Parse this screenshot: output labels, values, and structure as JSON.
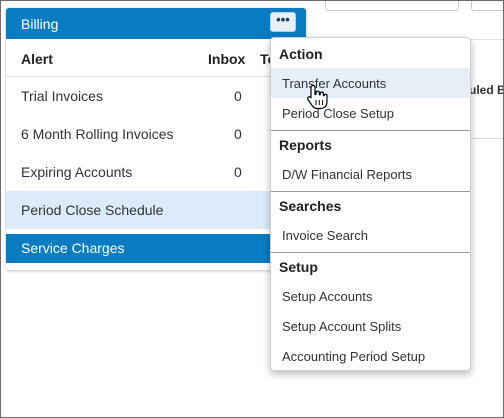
{
  "panel": {
    "title": "Billing",
    "more_label": "•••",
    "columns": {
      "alert": "Alert",
      "inbox": "Inbox",
      "third": "To"
    },
    "rows": [
      {
        "label": "Trial Invoices",
        "count": "0"
      },
      {
        "label": "6 Month Rolling Invoices",
        "count": "0"
      },
      {
        "label": "Expiring Accounts",
        "count": "0"
      },
      {
        "label": "Period Close Schedule",
        "count": ""
      }
    ],
    "service_charges": "Service Charges"
  },
  "background": {
    "header_fragment": "uled By"
  },
  "dropdown": {
    "sections": [
      {
        "heading": "Action",
        "items": [
          "Transfer Accounts",
          "Period Close Setup"
        ]
      },
      {
        "heading": "Reports",
        "items": [
          "D/W Financial Reports"
        ]
      },
      {
        "heading": "Searches",
        "items": [
          "Invoice Search"
        ]
      },
      {
        "heading": "Setup",
        "items": [
          "Setup Accounts",
          "Setup Account Splits",
          "Accounting Period Setup"
        ]
      }
    ],
    "hovered_item": "Transfer Accounts"
  },
  "colors": {
    "header_blue": "#0a7cc1",
    "selected_row": "#dcebfa",
    "hover_item": "#e6eef8"
  }
}
